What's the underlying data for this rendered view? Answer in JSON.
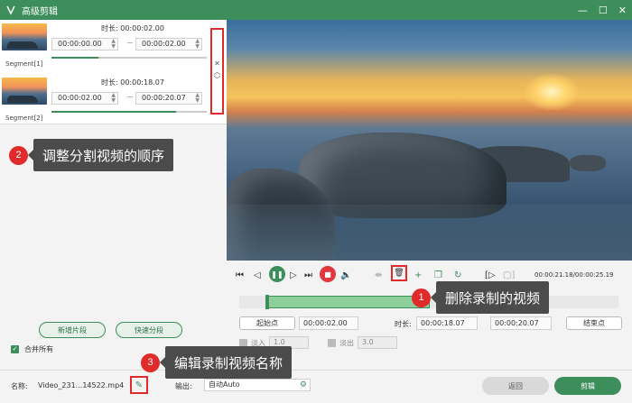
{
  "window": {
    "title": "高级剪辑",
    "controls": [
      "—",
      "☐",
      "✕"
    ]
  },
  "segments": [
    {
      "label": "Segment[1]",
      "duration_label": "时长:",
      "duration": "00:00:02.00",
      "start": "00:00:00.00",
      "end": "00:00:02.00",
      "progress": 0.3
    },
    {
      "label": "Segment[2]",
      "duration_label": "时长:",
      "duration": "00:00:18.07",
      "start": "00:00:02.00",
      "end": "00:00:20.07",
      "progress": 0.8
    }
  ],
  "reorder": {
    "remove": "✕",
    "up": "︿",
    "down": "﹀"
  },
  "left_actions": {
    "add_segment": "新增片段",
    "quick_split": "快速分段",
    "merge_all": "合并所有"
  },
  "player": {
    "timecode": "00:00:21.18/00:00:25.19"
  },
  "range": {
    "start_label": "起始点",
    "start_value": "00:00:02.00",
    "duration_label": "时长:",
    "duration_value": "00:00:18.07",
    "end_value": "00:00:20.07",
    "end_label": "结束点"
  },
  "fade": {
    "in_label": "淡入",
    "in_value": "1.0",
    "out_label": "淡出",
    "out_value": "3.0"
  },
  "bottom": {
    "name_label": "名称:",
    "file_name": "Video_231...14522.mp4",
    "output_label": "输出:",
    "output_value": "自动Auto",
    "back": "返回",
    "cut": "剪辑"
  },
  "callouts": [
    {
      "num": "1",
      "text": "删除录制的视频"
    },
    {
      "num": "2",
      "text": "调整分割视频的顺序"
    },
    {
      "num": "3",
      "text": "编辑录制视频名称"
    }
  ],
  "colors": {
    "accent": "#3e8e5c",
    "highlight": "#e02b2b",
    "stop": "#e0383e"
  }
}
